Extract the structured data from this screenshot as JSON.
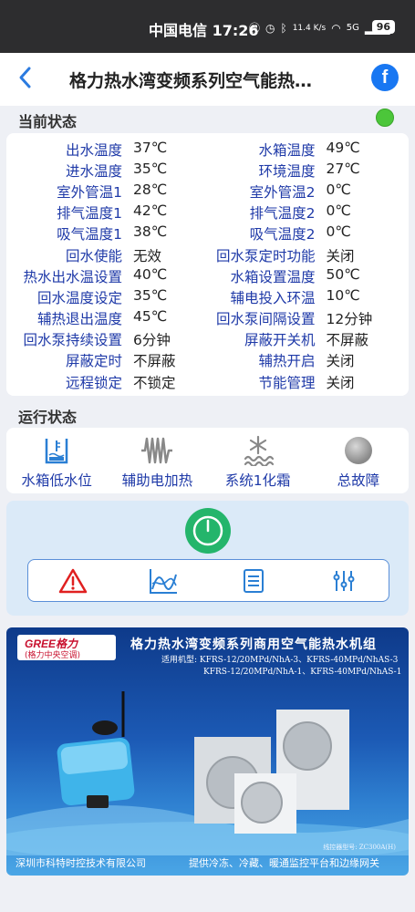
{
  "status_bar": {
    "carrier_time": "中国电信 17:26",
    "net_speed": "11.4 K/s",
    "network": "5G",
    "battery": "96"
  },
  "header": {
    "title": "格力热水湾变频系列空气能热…",
    "share_icon": "facebook-icon"
  },
  "current_status": {
    "title": "当前状态",
    "indicator_color": "#4cc63a",
    "rows": [
      [
        {
          "label": "出水温度",
          "value": "37℃"
        },
        {
          "label": "水箱温度",
          "value": "49℃"
        }
      ],
      [
        {
          "label": "进水温度",
          "value": "35℃"
        },
        {
          "label": "环境温度",
          "value": "27℃"
        }
      ],
      [
        {
          "label": "室外管温1",
          "value": "28℃"
        },
        {
          "label": "室外管温2",
          "value": "0℃"
        }
      ],
      [
        {
          "label": "排气温度1",
          "value": "42℃"
        },
        {
          "label": "排气温度2",
          "value": "0℃"
        }
      ],
      [
        {
          "label": "吸气温度1",
          "value": "38℃"
        },
        {
          "label": "吸气温度2",
          "value": "0℃"
        }
      ],
      [
        {
          "label": "回水使能",
          "value": "无效"
        },
        {
          "label": "回水泵定时功能",
          "value": "关闭"
        }
      ],
      [
        {
          "label": "热水出水温设置",
          "value": "40℃"
        },
        {
          "label": "水箱设置温度",
          "value": "50℃"
        }
      ],
      [
        {
          "label": "回水温度设定",
          "value": "35℃"
        },
        {
          "label": "辅电投入环温",
          "value": "10℃"
        }
      ],
      [
        {
          "label": "辅热退出温度",
          "value": "45℃"
        },
        {
          "label": "回水泵间隔设置",
          "value": "12分钟"
        }
      ],
      [
        {
          "label": "回水泵持续设置",
          "value": "6分钟"
        },
        {
          "label": "屏蔽开关机",
          "value": "不屏蔽"
        }
      ],
      [
        {
          "label": "屏蔽定时",
          "value": "不屏蔽"
        },
        {
          "label": "辅热开启",
          "value": "关闭"
        }
      ],
      [
        {
          "label": "远程锁定",
          "value": "不锁定"
        },
        {
          "label": "节能管理",
          "value": "关闭"
        }
      ]
    ]
  },
  "running_status": {
    "title": "运行状态",
    "items": [
      {
        "label": "水箱低水位",
        "icon": "water-level-icon"
      },
      {
        "label": "辅助电加热",
        "icon": "electric-heater-icon"
      },
      {
        "label": "系统1化霜",
        "icon": "defrost-icon"
      },
      {
        "label": "总故障",
        "icon": "fault-indicator-icon"
      }
    ]
  },
  "controls": {
    "power_icon": "power-icon",
    "power_color": "#24b56b",
    "tools": [
      "alarm-icon",
      "chart-icon",
      "list-icon",
      "settings-sliders-icon"
    ]
  },
  "banner": {
    "brand": "GREE格力",
    "brand_sub": "(格力中央空调)",
    "title": "格力热水湾变频系列商用空气能热水机组",
    "models_line1": "适用机型: KFRS-12/20MPd/NhA-3、KFRS-40MPd/NhAS-3",
    "models_line2": "KFRS-12/20MPd/NhA-1、KFRS-40MPd/NhAS-1",
    "controller": "线控器型号: ZC300A(H)",
    "company": "深圳市科特时控技术有限公司",
    "slogan": "提供冷冻、冷藏、暖通监控平台和边缘网关"
  }
}
